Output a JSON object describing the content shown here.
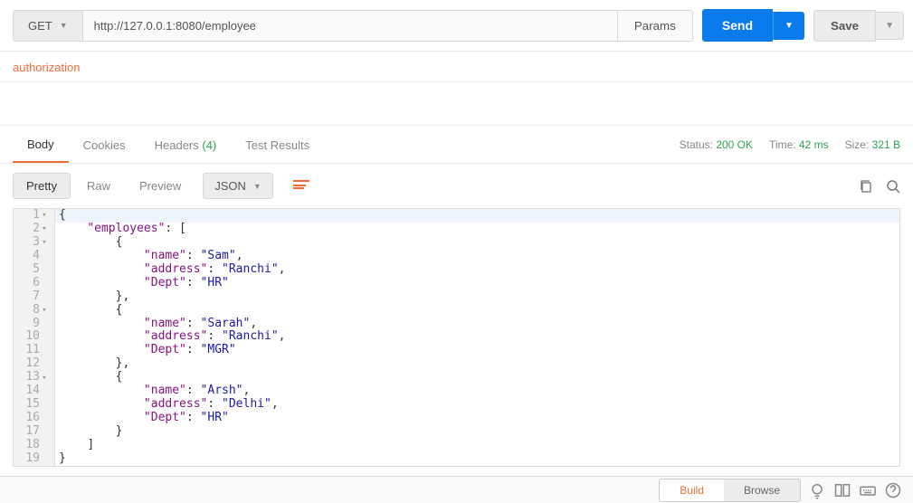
{
  "request": {
    "method": "GET",
    "url": "http://127.0.0.1:8080/employee",
    "params_label": "Params",
    "send_label": "Send",
    "save_label": "Save"
  },
  "auth": {
    "label": "authorization"
  },
  "response_tabs": {
    "body": "Body",
    "cookies": "Cookies",
    "headers": "Headers",
    "headers_count": "(4)",
    "test_results": "Test Results"
  },
  "status": {
    "status_label": "Status:",
    "status_value": "200 OK",
    "time_label": "Time:",
    "time_value": "42 ms",
    "size_label": "Size:",
    "size_value": "321 B"
  },
  "format": {
    "pretty": "Pretty",
    "raw": "Raw",
    "preview": "Preview",
    "type": "JSON"
  },
  "footer": {
    "build": "Build",
    "browse": "Browse"
  },
  "code_lines": [
    {
      "n": "1",
      "fold": true,
      "indent": 0,
      "tokens": [
        [
          "p",
          "{"
        ]
      ]
    },
    {
      "n": "2",
      "fold": true,
      "indent": 1,
      "tokens": [
        [
          "k",
          "\"employees\""
        ],
        [
          "p",
          ": ["
        ]
      ]
    },
    {
      "n": "3",
      "fold": true,
      "indent": 2,
      "tokens": [
        [
          "p",
          "{"
        ]
      ]
    },
    {
      "n": "4",
      "fold": false,
      "indent": 3,
      "tokens": [
        [
          "k",
          "\"name\""
        ],
        [
          "p",
          ": "
        ],
        [
          "s",
          "\"Sam\""
        ],
        [
          "p",
          ","
        ]
      ]
    },
    {
      "n": "5",
      "fold": false,
      "indent": 3,
      "tokens": [
        [
          "k",
          "\"address\""
        ],
        [
          "p",
          ": "
        ],
        [
          "s",
          "\"Ranchi\""
        ],
        [
          "p",
          ","
        ]
      ]
    },
    {
      "n": "6",
      "fold": false,
      "indent": 3,
      "tokens": [
        [
          "k",
          "\"Dept\""
        ],
        [
          "p",
          ": "
        ],
        [
          "s",
          "\"HR\""
        ]
      ]
    },
    {
      "n": "7",
      "fold": false,
      "indent": 2,
      "tokens": [
        [
          "p",
          "},"
        ]
      ]
    },
    {
      "n": "8",
      "fold": true,
      "indent": 2,
      "tokens": [
        [
          "p",
          "{"
        ]
      ]
    },
    {
      "n": "9",
      "fold": false,
      "indent": 3,
      "tokens": [
        [
          "k",
          "\"name\""
        ],
        [
          "p",
          ": "
        ],
        [
          "s",
          "\"Sarah\""
        ],
        [
          "p",
          ","
        ]
      ]
    },
    {
      "n": "10",
      "fold": false,
      "indent": 3,
      "tokens": [
        [
          "k",
          "\"address\""
        ],
        [
          "p",
          ": "
        ],
        [
          "s",
          "\"Ranchi\""
        ],
        [
          "p",
          ","
        ]
      ]
    },
    {
      "n": "11",
      "fold": false,
      "indent": 3,
      "tokens": [
        [
          "k",
          "\"Dept\""
        ],
        [
          "p",
          ": "
        ],
        [
          "s",
          "\"MGR\""
        ]
      ]
    },
    {
      "n": "12",
      "fold": false,
      "indent": 2,
      "tokens": [
        [
          "p",
          "},"
        ]
      ]
    },
    {
      "n": "13",
      "fold": true,
      "indent": 2,
      "tokens": [
        [
          "p",
          "{"
        ]
      ]
    },
    {
      "n": "14",
      "fold": false,
      "indent": 3,
      "tokens": [
        [
          "k",
          "\"name\""
        ],
        [
          "p",
          ": "
        ],
        [
          "s",
          "\"Arsh\""
        ],
        [
          "p",
          ","
        ]
      ]
    },
    {
      "n": "15",
      "fold": false,
      "indent": 3,
      "tokens": [
        [
          "k",
          "\"address\""
        ],
        [
          "p",
          ": "
        ],
        [
          "s",
          "\"Delhi\""
        ],
        [
          "p",
          ","
        ]
      ]
    },
    {
      "n": "16",
      "fold": false,
      "indent": 3,
      "tokens": [
        [
          "k",
          "\"Dept\""
        ],
        [
          "p",
          ": "
        ],
        [
          "s",
          "\"HR\""
        ]
      ]
    },
    {
      "n": "17",
      "fold": false,
      "indent": 2,
      "tokens": [
        [
          "p",
          "}"
        ]
      ]
    },
    {
      "n": "18",
      "fold": false,
      "indent": 1,
      "tokens": [
        [
          "p",
          "]"
        ]
      ]
    },
    {
      "n": "19",
      "fold": false,
      "indent": 0,
      "tokens": [
        [
          "p",
          "}"
        ]
      ]
    }
  ]
}
